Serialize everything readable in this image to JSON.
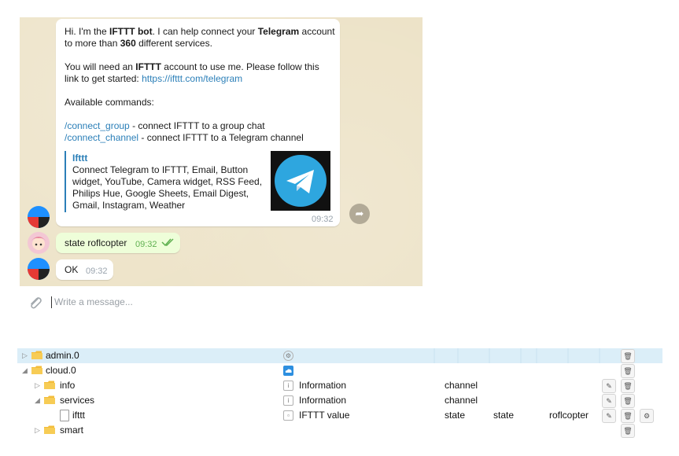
{
  "chat": {
    "bot_msg": {
      "p1": [
        "Hi. I'm the ",
        "IFTTT bot",
        ". I can help connect your ",
        "Telegram",
        " account to more than ",
        "360",
        " different services."
      ],
      "p2": [
        "You will need an ",
        "IFTTT",
        " account to use me. Please follow this link to get started: ",
        "https://ifttt.com/telegram"
      ],
      "p3": "Available commands:",
      "cmd1_link": "/connect_group",
      "cmd1_text": " - connect IFTTT to a group chat",
      "cmd2_link": "/connect_channel",
      "cmd2_text": " - connect IFTTT to a Telegram channel",
      "preview_title": "Ifttt",
      "preview_text": "Connect Telegram to IFTTT, Email, Button widget, YouTube, Camera widget, RSS Feed, Philips Hue, Google Sheets, Email Digest, Gmail, Instagram, Weather",
      "time": "09:32"
    },
    "out_msg": {
      "text": "state roflcopter",
      "time": "09:32",
      "check_icon": "double-check-icon"
    },
    "ok_msg": {
      "text": "OK",
      "time": "09:32"
    },
    "input_placeholder": "Write a message...",
    "colors": {
      "link": "#2b7fb8",
      "telegram_blue": "#2ea6df",
      "out_time": "#5fb050"
    }
  },
  "tree": {
    "rows": [
      {
        "name": "admin.0"
      },
      {
        "name": "cloud.0"
      },
      {
        "name": "info",
        "role": "Information",
        "type": "channel"
      },
      {
        "name": "services",
        "role": "Information",
        "type": "channel"
      },
      {
        "name": "ifttt",
        "role": "IFTTT value",
        "type": "state",
        "common_role": "state",
        "value": "roflcopter"
      },
      {
        "name": "smart"
      }
    ]
  }
}
